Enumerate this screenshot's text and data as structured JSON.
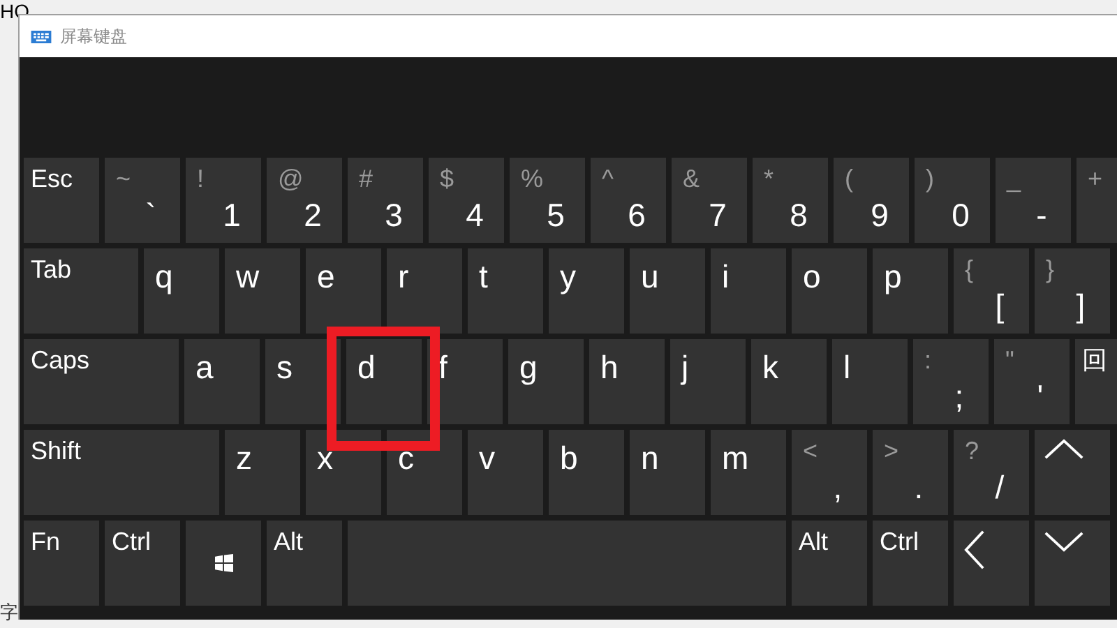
{
  "background": {
    "top_text": "HO",
    "bottom_text": "字"
  },
  "window": {
    "title": "屏幕键盘"
  },
  "rows": [
    [
      {
        "kind": "modifier",
        "label": "Esc"
      },
      {
        "kind": "symbol",
        "shift": "~",
        "main": "`"
      },
      {
        "kind": "symbol",
        "shift": "!",
        "main": "1"
      },
      {
        "kind": "symbol",
        "shift": "@",
        "main": "2"
      },
      {
        "kind": "symbol",
        "shift": "#",
        "main": "3"
      },
      {
        "kind": "symbol",
        "shift": "$",
        "main": "4"
      },
      {
        "kind": "symbol",
        "shift": "%",
        "main": "5"
      },
      {
        "kind": "symbol",
        "shift": "^",
        "main": "6"
      },
      {
        "kind": "symbol",
        "shift": "&",
        "main": "7"
      },
      {
        "kind": "symbol",
        "shift": "*",
        "main": "8"
      },
      {
        "kind": "symbol",
        "shift": "(",
        "main": "9"
      },
      {
        "kind": "symbol",
        "shift": ")",
        "main": "0"
      },
      {
        "kind": "symbol",
        "shift": "_",
        "main": "-"
      },
      {
        "kind": "symbol",
        "shift": "+"
      }
    ],
    [
      {
        "kind": "tab",
        "label": "Tab"
      },
      {
        "kind": "letter",
        "label": "q"
      },
      {
        "kind": "letter",
        "label": "w"
      },
      {
        "kind": "letter",
        "label": "e"
      },
      {
        "kind": "letter",
        "label": "r"
      },
      {
        "kind": "letter",
        "label": "t"
      },
      {
        "kind": "letter",
        "label": "y"
      },
      {
        "kind": "letter",
        "label": "u"
      },
      {
        "kind": "letter",
        "label": "i"
      },
      {
        "kind": "letter",
        "label": "o"
      },
      {
        "kind": "letter",
        "label": "p"
      },
      {
        "kind": "symbol",
        "shift": "{",
        "main": "["
      },
      {
        "kind": "symbol",
        "shift": "}",
        "main": "]"
      }
    ],
    [
      {
        "kind": "caps",
        "label": "Caps"
      },
      {
        "kind": "letter",
        "label": "a"
      },
      {
        "kind": "letter",
        "label": "s"
      },
      {
        "kind": "letter",
        "label": "d"
      },
      {
        "kind": "letter",
        "label": "f"
      },
      {
        "kind": "letter",
        "label": "g"
      },
      {
        "kind": "letter",
        "label": "h"
      },
      {
        "kind": "letter",
        "label": "j"
      },
      {
        "kind": "letter",
        "label": "k"
      },
      {
        "kind": "letter",
        "label": "l"
      },
      {
        "kind": "symbol",
        "shift": ":",
        "main": ";"
      },
      {
        "kind": "symbol",
        "shift": "\"",
        "main": "'"
      },
      {
        "kind": "modifier",
        "label": "回"
      }
    ],
    [
      {
        "kind": "shift",
        "label": "Shift"
      },
      {
        "kind": "letter",
        "label": "z"
      },
      {
        "kind": "letter",
        "label": "x"
      },
      {
        "kind": "letter",
        "label": "c"
      },
      {
        "kind": "letter",
        "label": "v"
      },
      {
        "kind": "letter",
        "label": "b"
      },
      {
        "kind": "letter",
        "label": "n"
      },
      {
        "kind": "letter",
        "label": "m"
      },
      {
        "kind": "symbol",
        "shift": "<",
        "main": ","
      },
      {
        "kind": "symbol",
        "shift": ">",
        "main": "."
      },
      {
        "kind": "symbol",
        "shift": "?",
        "main": "/"
      },
      {
        "kind": "arrow-up"
      }
    ],
    [
      {
        "kind": "modifier",
        "label": "Fn"
      },
      {
        "kind": "modifier",
        "label": "Ctrl"
      },
      {
        "kind": "windows"
      },
      {
        "kind": "modifier",
        "label": "Alt"
      },
      {
        "kind": "space"
      },
      {
        "kind": "modifier",
        "label": "Alt"
      },
      {
        "kind": "modifier",
        "label": "Ctrl"
      },
      {
        "kind": "arrow-left"
      },
      {
        "kind": "arrow-down"
      }
    ]
  ]
}
